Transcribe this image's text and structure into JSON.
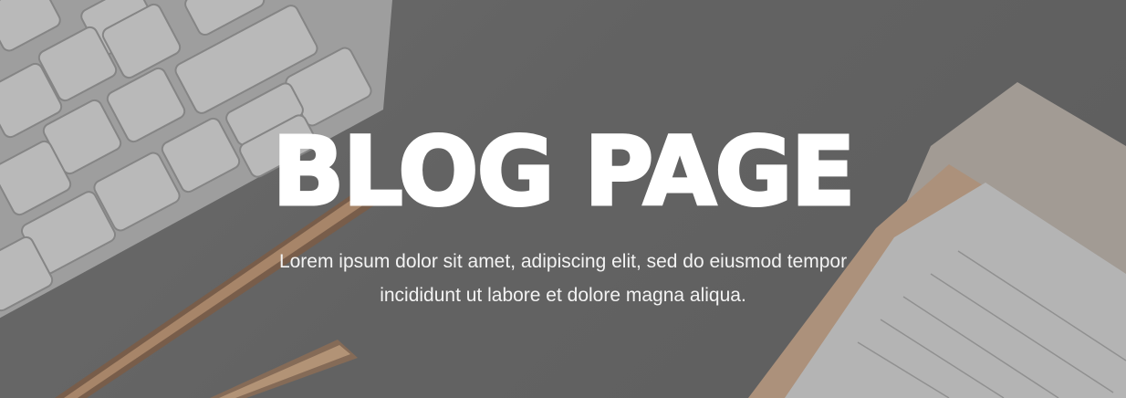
{
  "hero": {
    "title": "BLOG PAGE",
    "subtitle": "Lorem ipsum dolor sit amet,  adipiscing elit, sed do eiusmod tempor incididunt ut labore et dolore magna aliqua.",
    "background": "desk-photo",
    "overlay_color": "#2a2a2a",
    "text_color": "#ffffff"
  }
}
